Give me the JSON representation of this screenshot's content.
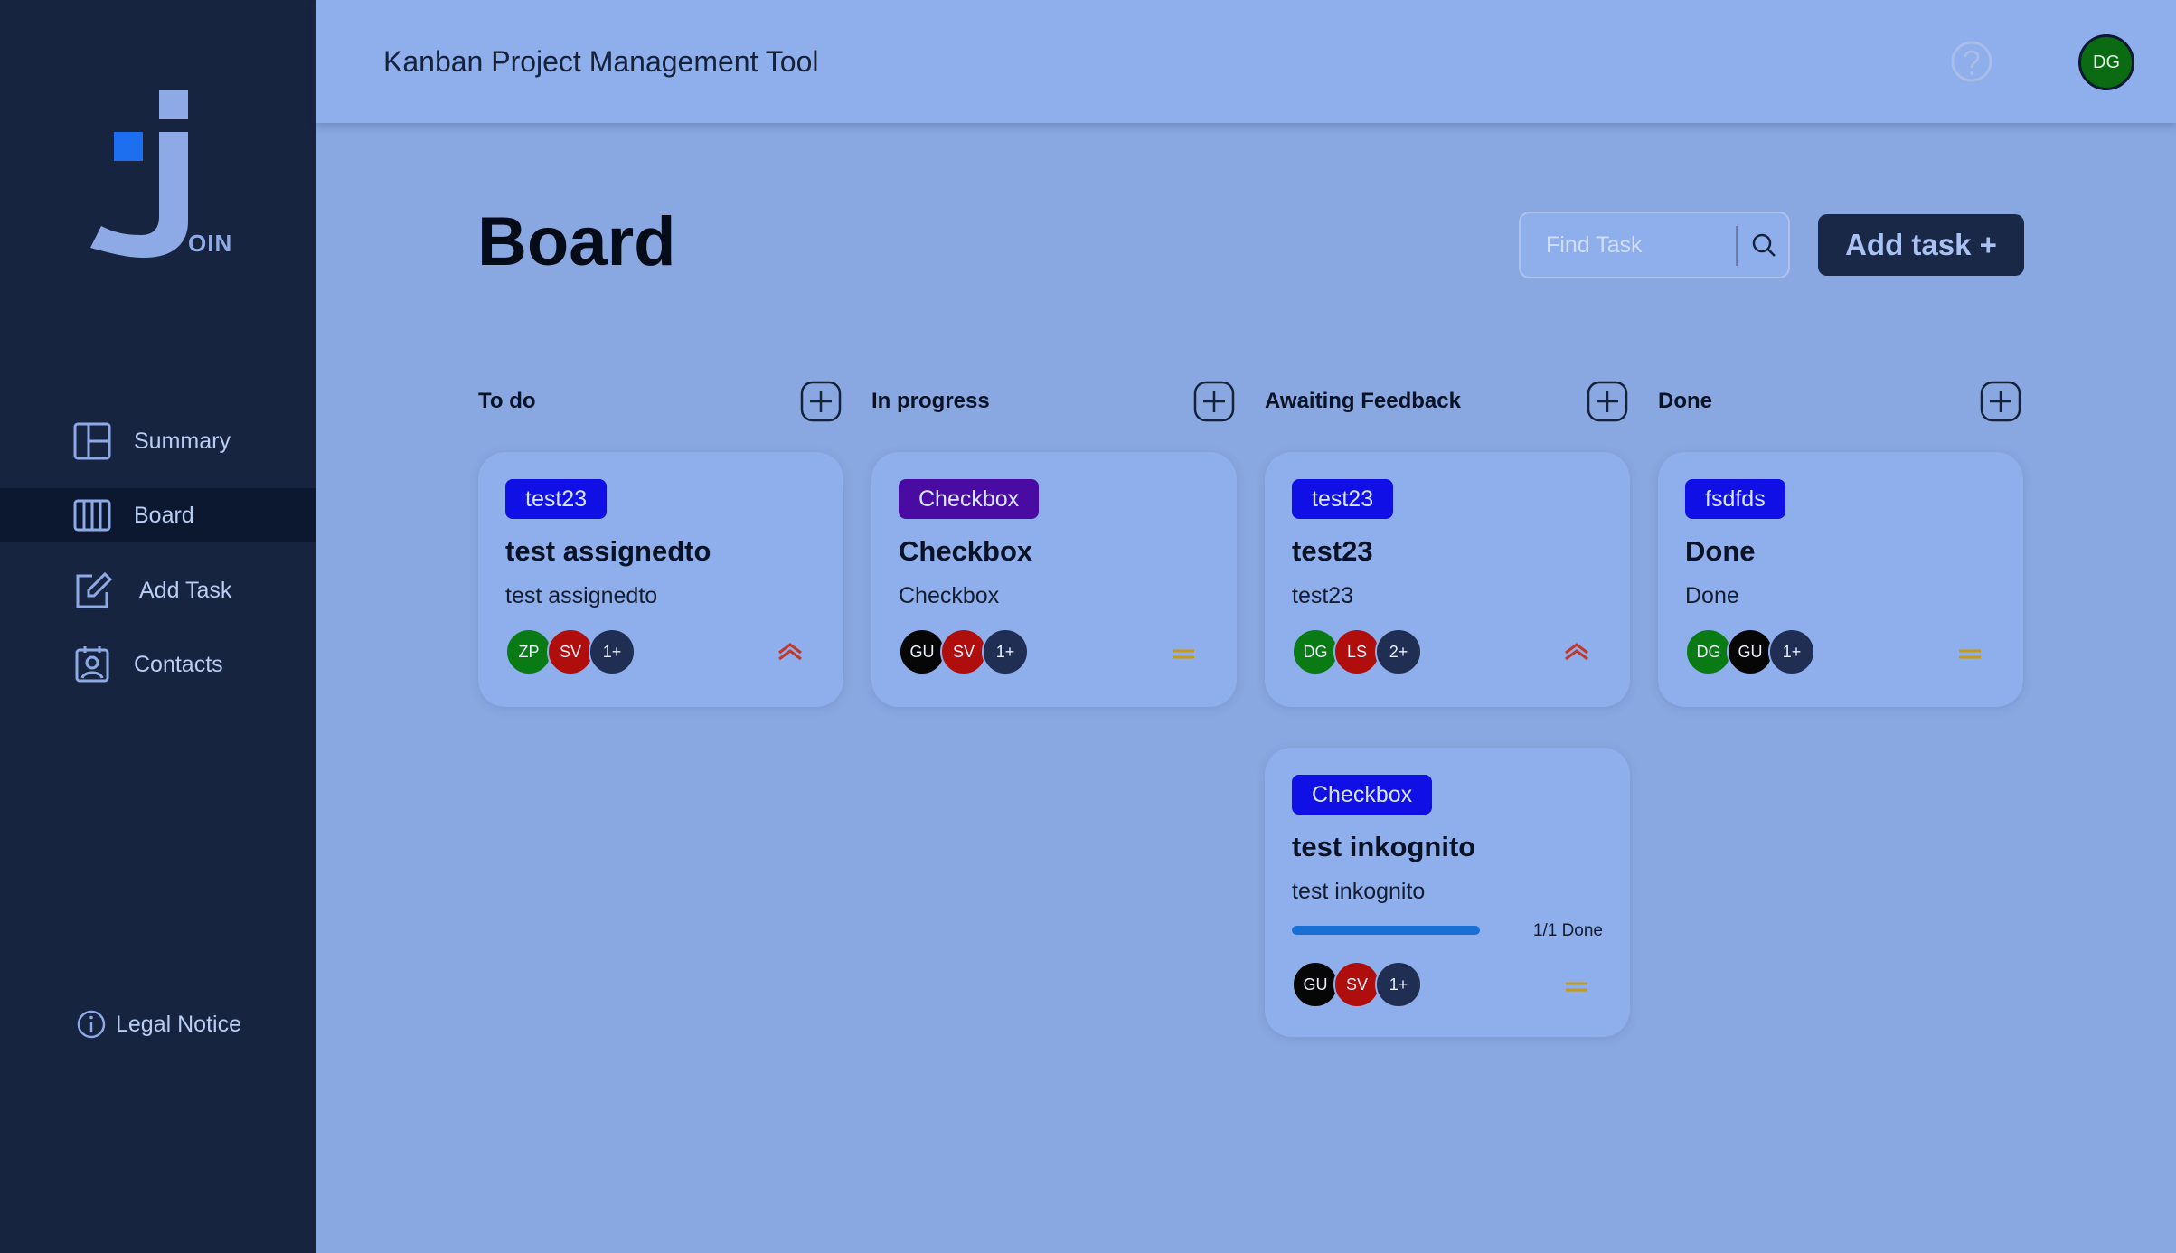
{
  "sidebar": {
    "logo_text": "OIN",
    "items": [
      {
        "label": "Summary",
        "icon": "summary-icon",
        "active": false
      },
      {
        "label": "Board",
        "icon": "board-icon",
        "active": true
      },
      {
        "label": "Add Task",
        "icon": "add-task-icon",
        "active": false
      },
      {
        "label": "Contacts",
        "icon": "contacts-icon",
        "active": false
      }
    ],
    "legal": "Legal Notice"
  },
  "header": {
    "title": "Kanban Project Management Tool",
    "user_initials": "DG"
  },
  "main": {
    "title": "Board",
    "search_placeholder": "Find Task",
    "add_task_label": "Add task +"
  },
  "columns": [
    {
      "title": "To do"
    },
    {
      "title": "In progress"
    },
    {
      "title": "Awaiting Feedback"
    },
    {
      "title": "Done"
    }
  ],
  "cards": [
    {
      "tag": "test23",
      "tag_color": "#0f0fe6",
      "title": "test assignedto",
      "desc": "test assignedto",
      "avatars": [
        {
          "i": "ZP",
          "c": "#0a7a14"
        },
        {
          "i": "SV",
          "c": "#b00d0d"
        },
        {
          "i": "1+",
          "c": "#1f2e52"
        }
      ],
      "priority": "urgent"
    },
    {
      "tag": "Checkbox",
      "tag_color": "#4a0ba3",
      "title": "Checkbox",
      "desc": "Checkbox",
      "avatars": [
        {
          "i": "GU",
          "c": "#060606"
        },
        {
          "i": "SV",
          "c": "#b00d0d"
        },
        {
          "i": "1+",
          "c": "#1f2e52"
        }
      ],
      "priority": "medium"
    },
    {
      "tag": "test23",
      "tag_color": "#0f0fe6",
      "title": "test23",
      "desc": "test23",
      "avatars": [
        {
          "i": "DG",
          "c": "#0a7a14"
        },
        {
          "i": "LS",
          "c": "#b00d0d"
        },
        {
          "i": "2+",
          "c": "#1f2e52"
        }
      ],
      "priority": "urgent"
    },
    {
      "tag": "fsdfds",
      "tag_color": "#0f0fe6",
      "title": "Done",
      "desc": "Done",
      "avatars": [
        {
          "i": "DG",
          "c": "#0a7a14"
        },
        {
          "i": "GU",
          "c": "#060606"
        },
        {
          "i": "1+",
          "c": "#1f2e52"
        }
      ],
      "priority": "medium"
    },
    {
      "tag": "Checkbox",
      "tag_color": "#0f0fe6",
      "title": "test inkognito",
      "desc": "test inkognito",
      "subtasks_done": 1,
      "subtasks_total": 1,
      "progress_text": "1/1 Done",
      "avatars": [
        {
          "i": "GU",
          "c": "#060606"
        },
        {
          "i": "SV",
          "c": "#b00d0d"
        },
        {
          "i": "1+",
          "c": "#1f2e52"
        }
      ],
      "priority": "medium"
    }
  ]
}
